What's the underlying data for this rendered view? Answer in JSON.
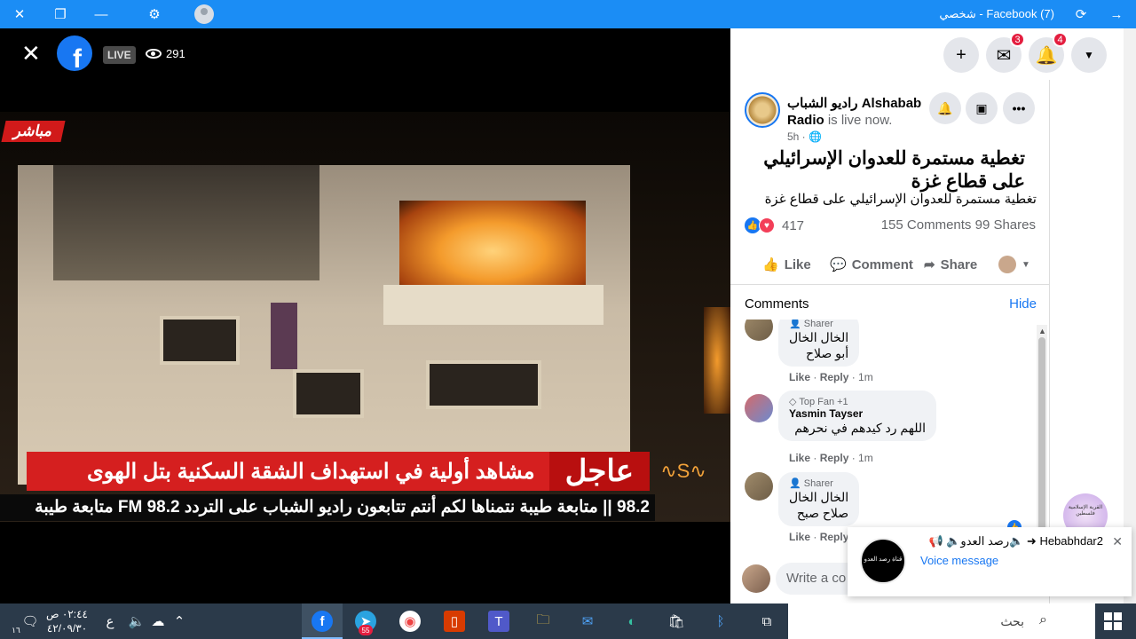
{
  "window": {
    "title": "(7) Facebook - شخصي"
  },
  "video": {
    "live_label": "LIVE",
    "viewers": "291",
    "live_tag": "مباشر",
    "news_urgent": "عاجل",
    "news_headline": "مشاهد أولية في استهداف الشقة السكنية بتل الهوى",
    "ticker": "98.2 || متابعة طيبة نتمناها لكم  أنتم تتابعون راديو الشباب على التردد FM 98.2 متابعة طيبة",
    "radio_logo_text": "Alshabab Radio"
  },
  "fb_header": {
    "messenger_badge": "3",
    "notifications_badge": "4"
  },
  "post": {
    "author_ar": "راديو الشباب",
    "author_en": "Alshabab Radio",
    "status": "is live now.",
    "time": "5h ·",
    "headline": "تغطية مستمرة للعدوان الإسرائيلي على قطاع غزة",
    "body": "تغطية مستمرة للعدوان الإسرائيلي على قطاع غزة",
    "reactions_count": "417",
    "comments_count": "155 Comments",
    "shares_count": "99 Shares",
    "like_label": "Like",
    "comment_label": "Comment",
    "share_label": "Share"
  },
  "comments_section": {
    "title": "Comments",
    "hide_label": "Hide",
    "items": [
      {
        "tag": "Sharer",
        "author": "",
        "text_line1": "الخال الخال",
        "text_line2": "أبو صلاح",
        "like": "Like",
        "reply": "Reply",
        "time": "1m"
      },
      {
        "tag": "Top Fan +1",
        "author": "Yasmin Tayser",
        "text_line1": "اللهم رد كيدهم في نحرهم",
        "text_line2": "",
        "like": "Like",
        "reply": "Reply",
        "time": "1m"
      },
      {
        "tag": "Sharer",
        "author": "",
        "text_line1": "الخال الخال",
        "text_line2": "صلاح صبح",
        "like": "Like",
        "reply": "Reply",
        "time": ""
      }
    ],
    "write_placeholder": "Write a co"
  },
  "notification": {
    "title": "Hebabhdar2 ➜ 🔈رصد العدو🔈 📢",
    "subtitle": "Voice message",
    "avatar_text": "قناة رصد العدو"
  },
  "side_avatar_text": "القرية الإسلامية فلسطين",
  "taskbar": {
    "search_placeholder": "بحث",
    "time": "٠٢:٤٤ ص",
    "date": "٤٢/٠٩/٣٠",
    "lang": "ع",
    "notif_count": "١٦",
    "telegram_badge": "55"
  }
}
